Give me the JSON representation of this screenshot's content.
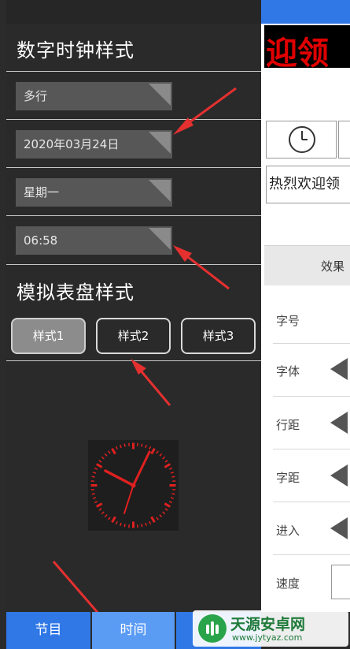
{
  "left": {
    "digital_title": "数字时钟样式",
    "combos": [
      "多行",
      "2020年03月24日",
      "星期一",
      "06:58"
    ],
    "analog_title": "模拟表盘样式",
    "style_buttons": [
      "样式1",
      "样式2",
      "样式3"
    ],
    "clock_color": "#e02020"
  },
  "right": {
    "banner_text": "迎领",
    "welcome_text": "热烈欢迎领",
    "effect_tab": "效果",
    "props": [
      "字号",
      "字体",
      "行距",
      "字距",
      "进入",
      "速度"
    ]
  },
  "tabs": [
    "节目",
    "时间",
    ""
  ],
  "colors": {
    "top_bar": "#2f78e6",
    "tab_bar": "#2f78e6",
    "tab_active": "#5a9bf4",
    "banner_text": "#e00000"
  },
  "watermark": {
    "brand": "天源安卓网",
    "url": "www.jytyaz.com"
  }
}
